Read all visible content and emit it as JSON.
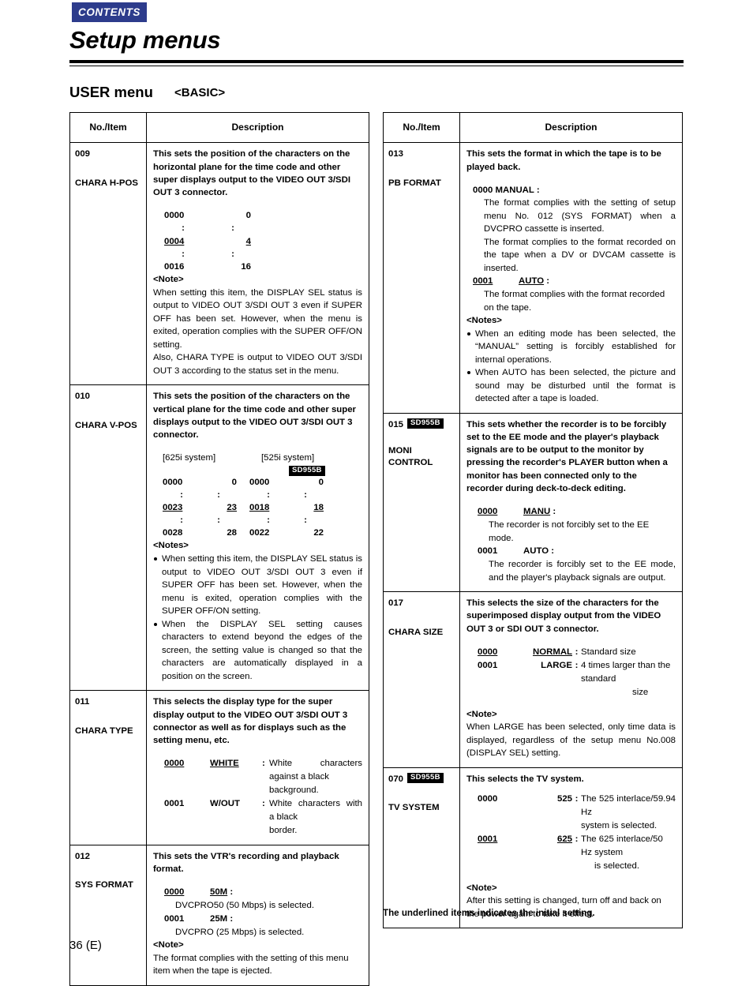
{
  "header": {
    "contents_tab": "CONTENTS",
    "title": "Setup menus",
    "section": "USER menu",
    "section_variant": "<BASIC>"
  },
  "table_headers": {
    "no_item": "No./Item",
    "description": "Description"
  },
  "badge_label": "SD955B",
  "left_column": [
    {
      "no": "009",
      "item": "CHARA H-POS",
      "lead": "This sets the position of the characters on the horizontal plane for the time code and other super displays output to the VIDEO OUT 3/SDI OUT 3 connector.",
      "values": [
        {
          "code": "0000",
          "val": "0",
          "underline": false
        },
        {
          "code": ":",
          "val": ":",
          "underline": false
        },
        {
          "code": "0004",
          "val": "4",
          "underline": true
        },
        {
          "code": ":",
          "val": ":",
          "underline": false
        },
        {
          "code": "0016",
          "val": "16",
          "underline": false
        }
      ],
      "note_label": "<Note>",
      "note_paragraphs": [
        "When setting this item, the DISPLAY SEL status is output to VIDEO OUT 3/SDI OUT 3 even if SUPER OFF has been set. However, when the menu is exited, operation complies with the SUPER OFF/ON setting.",
        "Also, CHARA TYPE is output to VIDEO OUT 3/SDI OUT 3 according to the status set in the menu."
      ]
    },
    {
      "no": "010",
      "item": "CHARA V-POS",
      "lead": "This sets the position of the characters on the vertical plane for the time code and other super displays output to the VIDEO OUT 3/SDI OUT 3 connector.",
      "system_labels": [
        "[625i system]",
        "[525i system]"
      ],
      "dual_values": [
        {
          "a_code": "0000",
          "a_val": "0",
          "b_code": "0000",
          "b_val": "0",
          "underline": false
        },
        {
          "a_code": ":",
          "a_val": ":",
          "b_code": ":",
          "b_val": ":",
          "underline": false
        },
        {
          "a_code": "0023",
          "a_val": "23",
          "b_code": "0018",
          "b_val": "18",
          "underline": true
        },
        {
          "a_code": ":",
          "a_val": ":",
          "b_code": ":",
          "b_val": ":",
          "underline": false
        },
        {
          "a_code": "0028",
          "a_val": "28",
          "b_code": "0022",
          "b_val": "22",
          "underline": false
        }
      ],
      "notes_label": "<Notes>",
      "notes": [
        "When setting this item, the DISPLAY SEL status is output to VIDEO OUT 3/SDI OUT 3 even if SUPER OFF has been set. However, when the menu is exited, operation complies with the SUPER OFF/ON setting.",
        "When the DISPLAY SEL setting causes characters to extend beyond the edges of the screen, the setting value is changed so that the characters are automatically displayed in a position on the screen."
      ]
    },
    {
      "no": "011",
      "item": "CHARA TYPE",
      "lead": "This selects the display type for the super display output to the VIDEO OUT 3/SDI OUT 3 connector as well as for displays such as the setting menu, etc.",
      "options": [
        {
          "code": "0000",
          "val": "WHITE",
          "underline": true,
          "desc": "White characters against a black",
          "cont": "background."
        },
        {
          "code": "0001",
          "val": "W/OUT",
          "underline": false,
          "desc": "White characters with a black",
          "cont": "border."
        }
      ]
    },
    {
      "no": "012",
      "item": "SYS FORMAT",
      "lead": "This sets the VTR's recording and playback format.",
      "options": [
        {
          "code": "0000",
          "val": "50M",
          "underline": true,
          "sub": "DVCPRO50 (50 Mbps) is selected."
        },
        {
          "code": "0001",
          "val": "25M",
          "underline": false,
          "sub": "DVCPRO (25 Mbps) is selected."
        }
      ],
      "note_label": "<Note>",
      "note_paragraphs": [
        "The format complies with the setting of this menu item when the tape is ejected."
      ]
    }
  ],
  "right_column": [
    {
      "no": "013",
      "item": "PB FORMAT",
      "lead": "This sets the format in which the tape is to be played back.",
      "options": [
        {
          "code": "0000",
          "val": "MANUAL",
          "underline": false,
          "compact": true,
          "subs": [
            "The format complies with the setting of setup menu No. 012 (SYS FORMAT) when a DVCPRO cassette is inserted.",
            "The format complies to the format recorded on the tape when a DV or DVCAM cassette is inserted."
          ]
        },
        {
          "code": "0001",
          "val": "AUTO",
          "underline": true,
          "compact": false,
          "subs": [
            "The format complies with the format recorded on the tape."
          ]
        }
      ],
      "notes_label": "<Notes>",
      "notes": [
        "When an editing mode has been selected, the “MANUAL” setting is forcibly established for internal operations.",
        "When AUTO has been selected, the picture and sound may be disturbed until the format is detected after a tape is loaded."
      ]
    },
    {
      "no": "015",
      "item": "MONI CONTROL",
      "item_lines": [
        "MONI",
        "CONTROL"
      ],
      "has_badge": true,
      "lead": "This sets whether the recorder is to be forcibly set to the EE mode and the player's playback signals are to be output to the monitor by pressing the recorder's PLAYER button when a monitor has been connected only to the recorder during deck-to-deck editing.",
      "options": [
        {
          "code": "0000",
          "val": "MANU",
          "underline": true,
          "subs": [
            "The recorder is not forcibly set to the EE mode."
          ]
        },
        {
          "code": "0001",
          "val": "AUTO",
          "underline": false,
          "subs": [
            "The recorder is forcibly set to the EE mode, and the player's playback signals are output."
          ]
        }
      ]
    },
    {
      "no": "017",
      "item": "CHARA SIZE",
      "lead": "This selects the size of the characters for the superimposed display output from the VIDEO OUT 3 or SDI OUT 3 connector.",
      "options": [
        {
          "code": "0000",
          "val": "NORMAL",
          "underline": true,
          "desc": "Standard size",
          "cont": ""
        },
        {
          "code": "0001",
          "val": "LARGE",
          "underline": false,
          "desc": "4 times larger than the standard",
          "cont": "size"
        }
      ],
      "note_label": "<Note>",
      "note_paragraphs": [
        "When LARGE has been selected, only time data is displayed, regardless of the setup menu No.008 (DISPLAY SEL) setting."
      ]
    },
    {
      "no": "070",
      "item": "TV SYSTEM",
      "has_badge": true,
      "lead": "This selects the TV system.",
      "options": [
        {
          "code": "0000",
          "val": "525",
          "underline": false,
          "desc": "The 525 interlace/59.94 Hz",
          "cont": "system is selected."
        },
        {
          "code": "0001",
          "val": "625",
          "underline": true,
          "desc": "The 625 interlace/50 Hz system",
          "cont": "is selected."
        }
      ],
      "note_label": "<Note>",
      "note_paragraphs": [
        "After this setting is changed, turn off and back on the power again to take it effect."
      ]
    }
  ],
  "footer": {
    "underline_note": "The underlined items indicates the initial setting.",
    "page_number": "36 (E)"
  }
}
